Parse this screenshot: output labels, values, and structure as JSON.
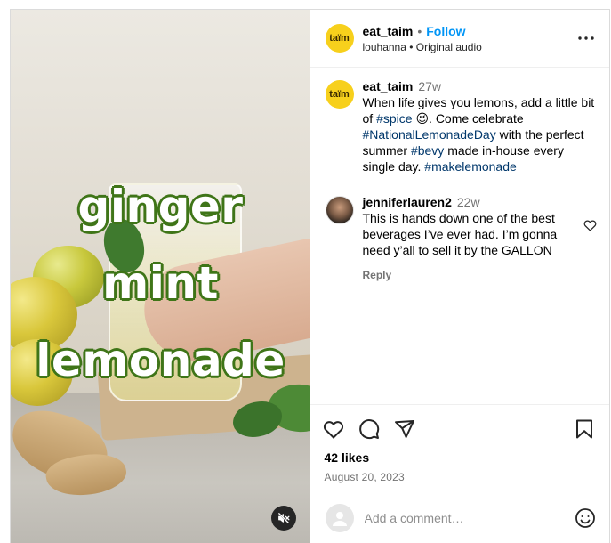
{
  "post": {
    "author": "eat_taim",
    "logo_text": "taïm",
    "follow_label": "Follow",
    "separator": "•",
    "audio_line": "louhanna • Original audio",
    "more_icon": "more-horizontal-icon"
  },
  "video": {
    "overlay_lines": [
      "ginger",
      "mint",
      "lemonade"
    ],
    "mute_icon": "muted-speaker-icon"
  },
  "caption": {
    "user": "eat_taim",
    "time": "27w",
    "text_1": "When life gives you lemons, add a little bit of ",
    "tag_spice": "#spice",
    "emoji_wink": "😉",
    "text_2": ". Come celebrate ",
    "tag_national": "#NationalLemonadeDay",
    "text_3": " with the perfect summer ",
    "tag_bevy": "#bevy",
    "text_4": " made in-house every single day. ",
    "tag_make": "#makelemonade"
  },
  "comments": [
    {
      "user": "jenniferlauren2",
      "time": "22w",
      "text": "This is hands down one of the best beverages I’ve ever had. I’m gonna need y’all to sell it by the GALLON",
      "reply_label": "Reply"
    }
  ],
  "actions": {
    "likes": "42 likes",
    "date": "August 20, 2023",
    "icons": [
      "heart-icon",
      "comment-icon",
      "share-icon",
      "bookmark-icon"
    ]
  },
  "add_comment": {
    "placeholder": "Add a comment…",
    "emoji_icon": "smiley-icon"
  },
  "colors": {
    "follow_blue": "#0095f6",
    "hashtag_blue": "#00376b",
    "logo_yellow": "#f7d01c",
    "overlay_green": "#3f7518"
  }
}
